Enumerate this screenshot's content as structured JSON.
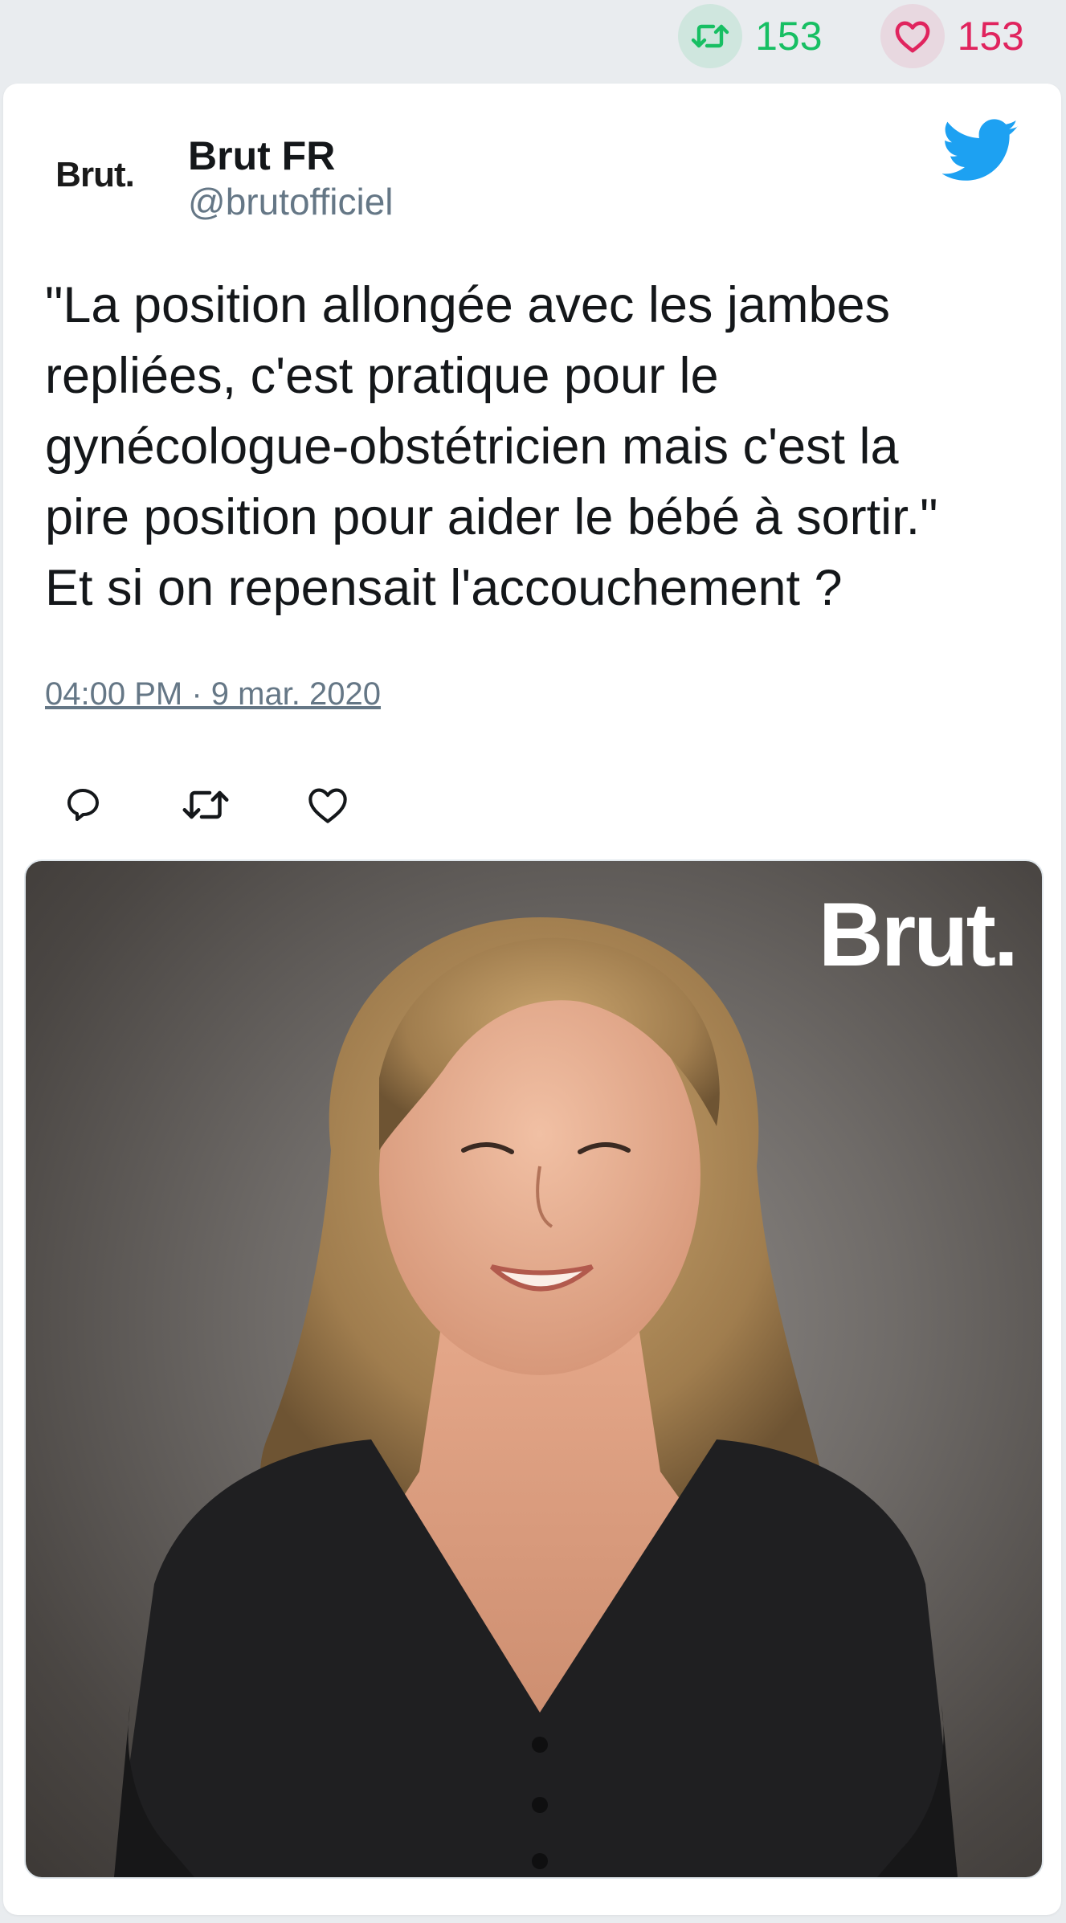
{
  "stats": {
    "retweet_count": "153",
    "like_count": "153"
  },
  "author": {
    "avatar_logo": "Brut.",
    "name": "Brut FR",
    "handle": "@brutofficiel"
  },
  "tweet": {
    "text": "\"La position allongée avec les jambes\nrepliées, c'est pratique pour le\ngynécologue-obstétricien mais c'est la\npire position pour aider le bébé à sortir.\"\nEt si on repensait l'accouchement ?",
    "timestamp": "04:00 PM · 9 mar. 2020"
  },
  "media": {
    "watermark": "Brut."
  },
  "colors": {
    "retweet": "#17bf63",
    "like": "#e0245e",
    "twitter_blue": "#1da1f2",
    "secondary_text": "#657786"
  },
  "icons": {
    "top_retweet": "retweet-icon",
    "top_like": "heart-icon",
    "brand": "twitter-bird-icon",
    "reply": "reply-icon",
    "retweet": "retweet-icon",
    "like": "heart-icon"
  }
}
